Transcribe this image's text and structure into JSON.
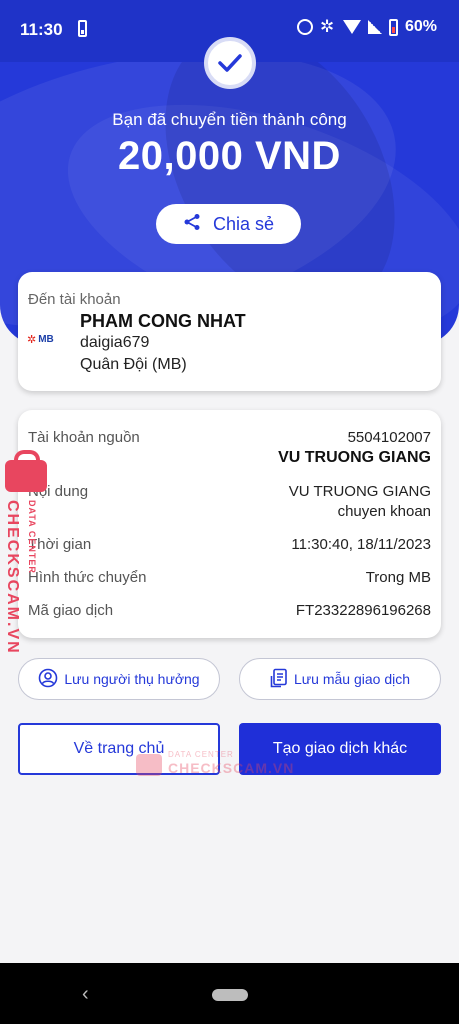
{
  "status_bar": {
    "time": "11:30",
    "battery": "60%"
  },
  "success": {
    "message": "Bạn đã chuyển tiền thành công",
    "amount": "20,000 VND",
    "share_label": "Chia sẻ"
  },
  "recipient": {
    "heading": "Đến tài khoản",
    "bank_logo": "MB",
    "name": "PHAM CONG NHAT",
    "account": "daigia679",
    "bank": "Quân Đội (MB)"
  },
  "details": {
    "source_label": "Tài khoản nguồn",
    "source_number": "5504102007",
    "source_name": "VU TRUONG GIANG",
    "content_label": "Nội dung",
    "content_line1": "VU TRUONG GIANG",
    "content_line2": "chuyen khoan",
    "time_label": "Thời gian",
    "time_value": "11:30:40, 18/11/2023",
    "method_label": "Hình thức chuyển",
    "method_value": "Trong MB",
    "txid_label": "Mã giao dịch",
    "txid_value": "FT23322896196268"
  },
  "actions": {
    "save_beneficiary": "Lưu người thụ hưởng",
    "save_template": "Lưu mẫu giao dịch",
    "home": "Về trang chủ",
    "new_transaction": "Tạo giao dịch khác"
  },
  "watermark": {
    "brand": "CHECKSCAM.VN",
    "tagline": "DATA CENTER"
  },
  "colors": {
    "primary": "#2539d9",
    "watermark": "#e8465f"
  }
}
